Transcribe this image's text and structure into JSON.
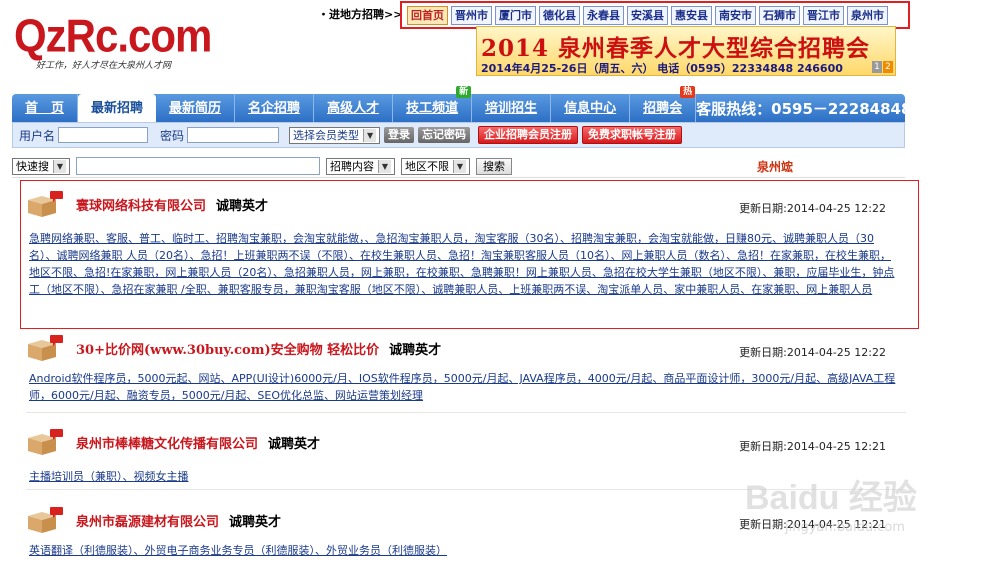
{
  "site": {
    "logo": "QzRc.com",
    "slogan": "好工作，好人才尽在大泉州人才网"
  },
  "city_nav": {
    "label": "・进地方招聘>>",
    "items": [
      "回首页",
      "晋州市",
      "厦门市",
      "德化县",
      "永春县",
      "安溪县",
      "惠安县",
      "南安市",
      "石狮市",
      "晋江市",
      "泉州市"
    ]
  },
  "banner": {
    "title": "2014 泉州春季人才大型综合招聘会",
    "subtitle": "2014年4月25-26日（周五、六） 电话（0595）22334848  246600",
    "pages": [
      "1",
      "2"
    ]
  },
  "main_nav": {
    "items": [
      {
        "label": "首　页",
        "badge": ""
      },
      {
        "label": "最新招聘",
        "badge": ""
      },
      {
        "label": "最新简历",
        "badge": ""
      },
      {
        "label": "名企招聘",
        "badge": ""
      },
      {
        "label": "高级人才",
        "badge": ""
      },
      {
        "label": "技工频道",
        "badge": "新"
      },
      {
        "label": "培训招生",
        "badge": ""
      },
      {
        "label": "信息中心",
        "badge": ""
      },
      {
        "label": "招聘会",
        "badge": "热"
      }
    ],
    "hotline": "客服热线：0595－22284848"
  },
  "login": {
    "username_label": "用户名",
    "password_label": "密码",
    "member_type": "选择会员类型",
    "login_btn": "登录",
    "forgot_btn": "忘记密码",
    "company_reg_btn": "企业招聘会员注册",
    "job_reg_btn": "免费求职帐号注册"
  },
  "search": {
    "quick": "快速搜",
    "field": "招聘内容",
    "region": "地区不限",
    "button": "搜索",
    "city": "泉州竤"
  },
  "companies": [
    {
      "name": "寰球网络科技有限公司",
      "hire": "诚聘英才",
      "date": "更新日期:2014-04-25 12:22",
      "jobs": "急聘网络兼职、客服、普工、临时工、招聘淘宝兼职，会淘宝就能做，、急招淘宝兼职人员，淘宝客服（30名）、招聘淘宝兼职，会淘宝就能做，日赚80元、诚聘兼职人员（30名）、诚聘网络兼职 人员（20名）、急招！上班兼职两不误（不限）、在校生兼职人员、急招！淘宝兼职客服人员（10名）、网上兼职人员（数名）、急招！在家兼职，在校生兼职，地区不限、急招!在家兼职，网上兼职人员（20名）、急招兼职人员，网上兼职，在校兼职、急聘兼职！网上兼职人员、急招在校大学生兼职（地区不限）、兼职，应届毕业生，钟点工（地区不限）、急招在家兼职 /全职、兼职客服专员，兼职淘宝客服（地区不限）、诚聘兼职人员、上班兼职两不误、淘宝派单人员、家中兼职人员、在家兼职、网上兼职人员"
    },
    {
      "name": "30+比价网(www.30buy.com)安全购物 轻松比价",
      "hire": "诚聘英才",
      "date": "更新日期:2014-04-25 12:22",
      "jobs": "Android软件程序员，5000元起、网站、APP(UI设计)6000元/月、IOS软件程序员，5000元/月起、JAVA程序员，4000元/月起、商品平面设计师，3000元/月起、高级JAVA工程师，6000元/月起、融资专员，5000元/月起、SEO优化总监、网站运营策划经理"
    },
    {
      "name": "泉州市棒棒糖文化传播有限公司",
      "hire": "诚聘英才",
      "date": "更新日期:2014-04-25 12:21",
      "jobs": "主播培训员（兼职）、视频女主播"
    },
    {
      "name": "泉州市磊源建材有限公司",
      "hire": "诚聘英才",
      "date": "更新日期:2014-04-25 12:21",
      "jobs": "英语翻译（利德服装）、外贸电子商务业务专员（利德服装）、外贸业务员（利德服装）"
    }
  ],
  "watermark": {
    "text": "Baidu 经验",
    "sub": "jingyan.baidu.com"
  }
}
